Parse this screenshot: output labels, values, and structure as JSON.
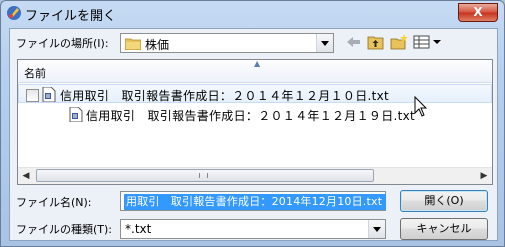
{
  "window": {
    "title": "ファイルを開く",
    "close_label": "X"
  },
  "location": {
    "label": "ファイルの場所(I):",
    "value": "株価"
  },
  "list": {
    "header": "名前",
    "files": [
      {
        "name": "信用取引　取引報告書作成日：２０１４年１２月１０日.txt",
        "selected": true
      },
      {
        "name": "信用取引　取引報告書作成日：２０１４年１２月１９日.txt",
        "selected": false
      }
    ]
  },
  "filename": {
    "label": "ファイル名(N):",
    "value": "用取引　取引報告書作成日：2014年12月10日.txt"
  },
  "filetype": {
    "label": "ファイルの種類(T):",
    "value": "*.txt"
  },
  "buttons": {
    "open": "開く(O)",
    "cancel": "キャンセル"
  },
  "icons": [
    "app-icon",
    "folder-icon",
    "back-icon",
    "up-folder-icon",
    "new-folder-icon",
    "view-menu-icon",
    "text-file-icon"
  ]
}
